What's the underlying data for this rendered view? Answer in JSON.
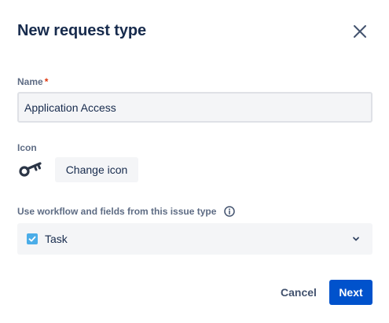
{
  "dialog": {
    "title": "New request type",
    "close_icon": "close-icon"
  },
  "name_field": {
    "label": "Name",
    "required_marker": "*",
    "value": "Application Access"
  },
  "icon_field": {
    "label": "Icon",
    "current_icon": "key-icon",
    "change_label": "Change icon"
  },
  "issue_type_field": {
    "label": "Use workflow and fields from this issue type",
    "info_icon": "info-icon",
    "selected": "Task",
    "selected_icon": "task-checkbox-icon",
    "chevron_icon": "chevron-down-icon"
  },
  "footer": {
    "cancel_label": "Cancel",
    "next_label": "Next"
  },
  "colors": {
    "primary": "#0052cc",
    "task_icon": "#4bade8",
    "required": "#de350b",
    "text": "#172b4d",
    "field_bg": "#f4f5f7"
  }
}
